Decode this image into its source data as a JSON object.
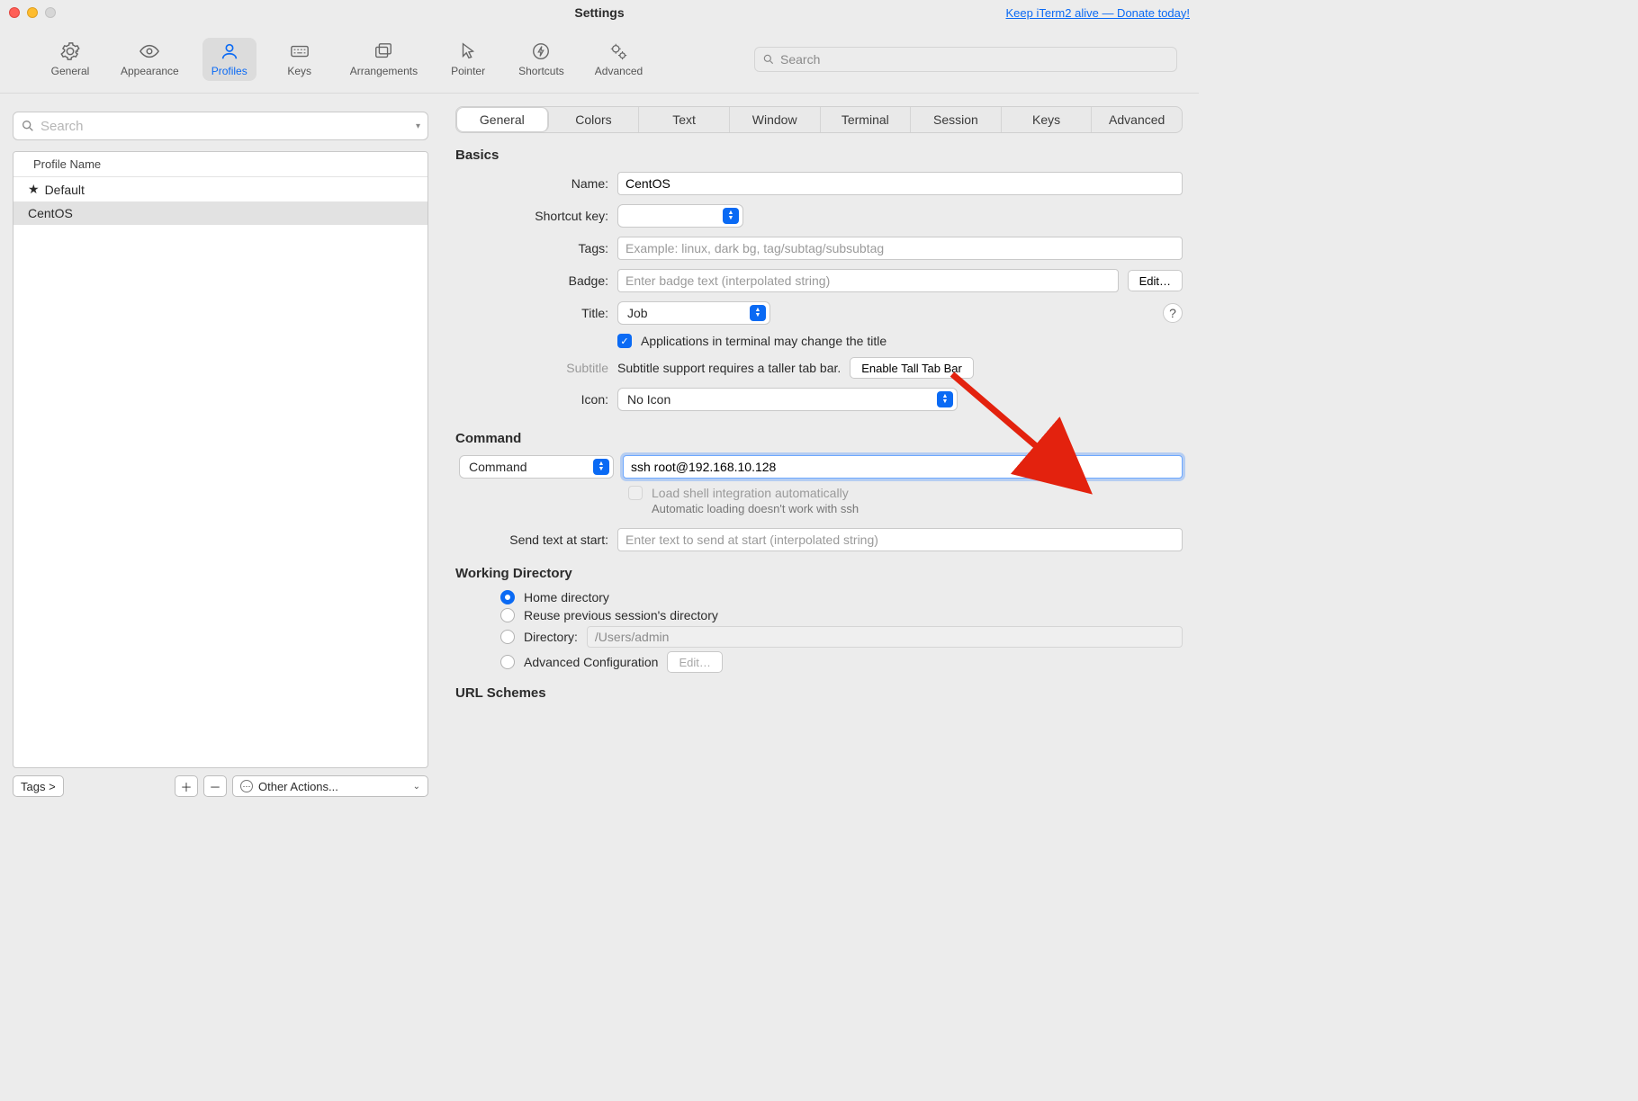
{
  "titlebar": {
    "title": "Settings",
    "donate": "Keep iTerm2 alive — Donate today!"
  },
  "toolbar": {
    "items": [
      {
        "label": "General"
      },
      {
        "label": "Appearance"
      },
      {
        "label": "Profiles"
      },
      {
        "label": "Keys"
      },
      {
        "label": "Arrangements"
      },
      {
        "label": "Pointer"
      },
      {
        "label": "Shortcuts"
      },
      {
        "label": "Advanced"
      }
    ],
    "search_placeholder": "Search"
  },
  "sidebar": {
    "search_placeholder": "Search",
    "header": "Profile Name",
    "rows": [
      {
        "label": "Default",
        "starred": true
      },
      {
        "label": "CentOS",
        "starred": false
      }
    ],
    "tags_button": "Tags >",
    "other_actions": "Other Actions..."
  },
  "sub_tabs": [
    "General",
    "Colors",
    "Text",
    "Window",
    "Terminal",
    "Session",
    "Keys",
    "Advanced"
  ],
  "basics": {
    "section": "Basics",
    "name_label": "Name:",
    "name_value": "CentOS",
    "shortcut_label": "Shortcut key:",
    "tags_label": "Tags:",
    "tags_placeholder": "Example: linux, dark bg, tag/subtag/subsubtag",
    "badge_label": "Badge:",
    "badge_placeholder": "Enter badge text (interpolated string)",
    "badge_edit": "Edit…",
    "title_label": "Title:",
    "title_value": "Job",
    "apps_change_title": "Applications in terminal may change the title",
    "subtitle_label": "Subtitle",
    "subtitle_msg": "Subtitle support requires a taller tab bar.",
    "subtitle_btn": "Enable Tall Tab Bar",
    "icon_label": "Icon:",
    "icon_value": "No Icon"
  },
  "command": {
    "section": "Command",
    "dropdown_value": "Command",
    "cmd_value": "ssh root@192.168.10.128",
    "load_shell_label": "Load shell integration automatically",
    "load_shell_note": "Automatic loading doesn't work with ssh",
    "send_text_label": "Send text at start:",
    "send_text_placeholder": "Enter text to send at start (interpolated string)"
  },
  "workdir": {
    "section": "Working Directory",
    "home": "Home directory",
    "reuse": "Reuse previous session's directory",
    "dir_label": "Directory:",
    "dir_value": "/Users/admin",
    "adv": "Advanced Configuration",
    "adv_edit": "Edit…"
  },
  "url": {
    "section": "URL Schemes"
  }
}
